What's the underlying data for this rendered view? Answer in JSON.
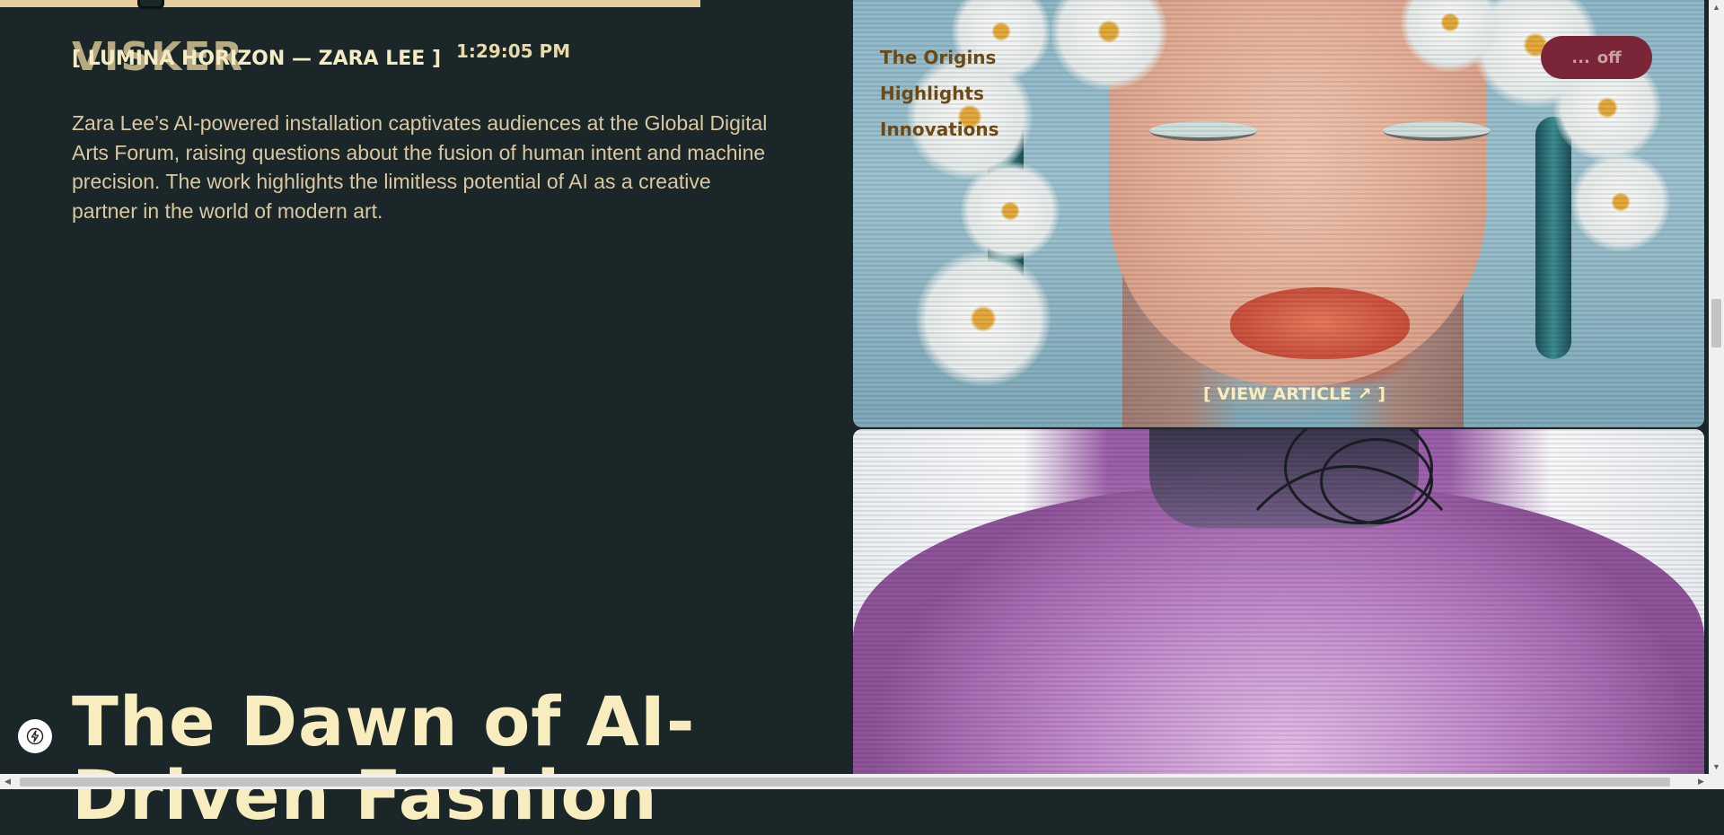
{
  "brand": {
    "ghost_text": "VISKER"
  },
  "article": {
    "tag": "[ LUMINA HORIZON — ZARA LEE ]",
    "time": "1:29:05 PM",
    "description": "Zara Lee’s AI-powered installation captivates audiences at the Global Digital Arts Forum, raising questions about the fusion of human intent and machine precision. The work highlights the limitless potential of AI as a creative partner in the world of modern art.",
    "headline": "The Dawn of AI-Driven Fashion"
  },
  "toc": {
    "items": [
      "The Origins",
      "Highlights",
      "Innovations"
    ]
  },
  "sound_toggle": {
    "dots": "...",
    "label": "off"
  },
  "card1": {
    "cta_label": "[  VIEW ARTICLE ↗  ]"
  },
  "icons": {
    "bolt": "bolt-icon",
    "arrow_up_right": "arrow-up-right-icon"
  },
  "colors": {
    "background": "#1a2628",
    "headline": "#f7edbe",
    "body_text": "#d9c8a1",
    "accent_bar": "#e6cf9c",
    "toc_text": "#6b4a17",
    "pill": "#7a2538"
  }
}
